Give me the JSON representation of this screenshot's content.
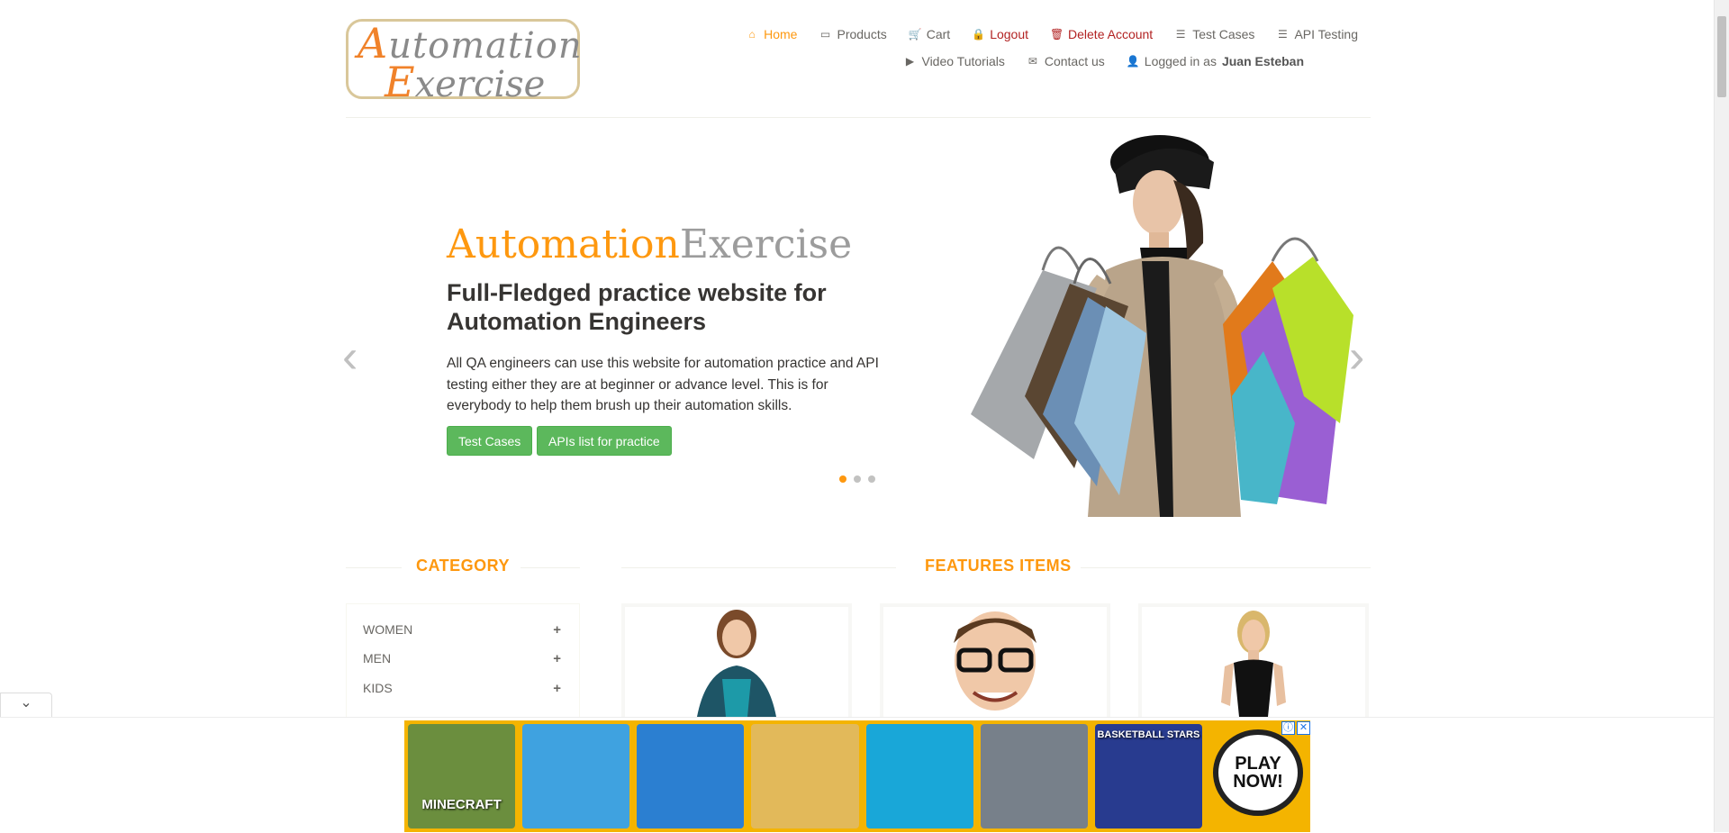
{
  "logo": {
    "line1": "utomation",
    "line1_cap": "A",
    "line2": "xercise",
    "line2_cap": "E"
  },
  "nav": {
    "row1": [
      {
        "label": "Home",
        "icon": "home-icon",
        "glyph": "⌂",
        "active": true
      },
      {
        "label": "Products",
        "icon": "briefcase-icon",
        "glyph": "▭"
      },
      {
        "label": "Cart",
        "icon": "cart-icon",
        "glyph": "🛒"
      },
      {
        "label": "Logout",
        "icon": "lock-icon",
        "glyph": "🔒",
        "style": "red"
      },
      {
        "label": "Delete Account",
        "icon": "trash-icon",
        "glyph": "🗑",
        "style": "red"
      },
      {
        "label": "Test Cases",
        "icon": "list-icon",
        "glyph": "☰"
      },
      {
        "label": "API Testing",
        "icon": "list-icon",
        "glyph": "☰"
      }
    ],
    "row2": [
      {
        "label": "Video Tutorials",
        "icon": "youtube-icon",
        "glyph": "▶"
      },
      {
        "label": "Contact us",
        "icon": "envelope-icon",
        "glyph": "✉"
      },
      {
        "label_prefix": "Logged in as",
        "user": "Juan Esteban",
        "icon": "user-icon",
        "glyph": "👤"
      }
    ]
  },
  "hero": {
    "brand_1": "Automation",
    "brand_2": "Exercise",
    "title": "Full-Fledged practice website for Automation Engineers",
    "text": "All QA engineers can use this website for automation practice and API testing either they are at beginner or advance level. This is for everybody to help them brush up their automation skills.",
    "btn_test_cases": "Test Cases",
    "btn_apis": "APIs list for practice",
    "prev_glyph": "‹",
    "next_glyph": "›"
  },
  "category": {
    "title": "CATEGORY",
    "items": [
      {
        "label": "WOMEN"
      },
      {
        "label": "MEN"
      },
      {
        "label": "KIDS"
      }
    ],
    "expand_glyph": "+"
  },
  "features": {
    "title": "FEATURES ITEMS"
  },
  "ad": {
    "toggle_glyph": "⌄",
    "tiles": [
      {
        "label": "MINECRAFT",
        "color": "#6b8e3e"
      },
      {
        "label": "",
        "color": "#3fa2e0"
      },
      {
        "label": "",
        "color": "#2b7fd1"
      },
      {
        "label": "",
        "color": "#e2b95a"
      },
      {
        "label": "",
        "color": "#19a7d8"
      },
      {
        "label": "",
        "color": "#77808a"
      },
      {
        "label": "BASKETBALL STARS",
        "color": "#283b8f"
      }
    ],
    "play_now": "PLAY NOW!",
    "info_glyph": "ⓘ",
    "close_glyph": "✕"
  },
  "colors": {
    "accent": "#fe980f",
    "button_green": "#5cb85c",
    "logout_red": "#b22222"
  }
}
